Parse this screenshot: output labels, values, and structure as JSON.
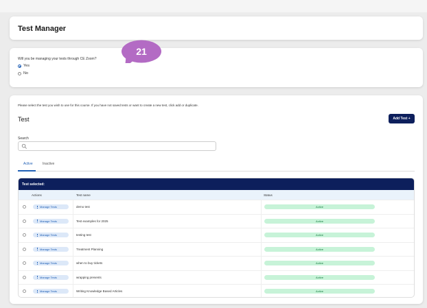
{
  "header": {
    "title": "Test Manager"
  },
  "question": {
    "text": "Will you be managing your tests through CE Zoom?",
    "options": [
      {
        "label": "Yes",
        "selected": true
      },
      {
        "label": "No",
        "selected": false
      }
    ]
  },
  "annotation_badge": {
    "label": "21",
    "color": "#b36bc4"
  },
  "main": {
    "intro": "Please select the test you wish to use for this course. If you have not saved tests or want to create a new test, click add or duplicate.",
    "section_title": "Test",
    "add_button": "Add Test +",
    "search_label": "Search",
    "search_placeholder": "",
    "tabs": [
      {
        "label": "Active",
        "active": true
      },
      {
        "label": "Inactive",
        "active": false
      }
    ]
  },
  "table": {
    "bar_title": "Test selected:",
    "headers": {
      "actions": "Actions",
      "name": "Test name",
      "status": "Status"
    },
    "manage_label": "Manage Tests",
    "rows": [
      {
        "name": "demo test",
        "status": "Active"
      },
      {
        "name": "Test examples for 2025",
        "status": "Active"
      },
      {
        "name": "testing test",
        "status": "Active"
      },
      {
        "name": "Treatment Planning",
        "status": "Active"
      },
      {
        "name": "when to buy tickets",
        "status": "Active"
      },
      {
        "name": "wrapping presents",
        "status": "Active"
      },
      {
        "name": "Writing Knowledge Based Articles",
        "status": "Active"
      }
    ]
  },
  "colors": {
    "navy": "#0d1f5c",
    "accent": "#1f5fb5",
    "status_bg": "#c7f3d8"
  }
}
